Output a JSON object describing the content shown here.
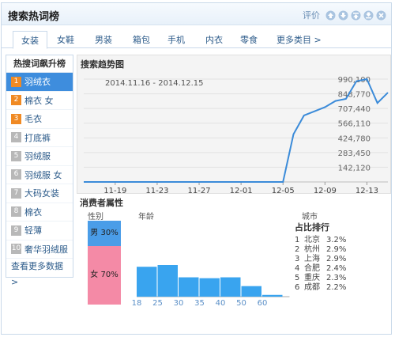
{
  "header": {
    "title": "搜索热词榜",
    "rating_label": "评价"
  },
  "tabs": [
    {
      "label": "女装",
      "active": true
    },
    {
      "label": "女鞋"
    },
    {
      "label": "男装"
    },
    {
      "label": "箱包"
    },
    {
      "label": "手机"
    },
    {
      "label": "内衣"
    },
    {
      "label": "零食"
    },
    {
      "label": "更多类目 >"
    }
  ],
  "sidebar": {
    "title": "热搜词飙升榜",
    "items": [
      {
        "rank": "1",
        "label": "羽绒衣",
        "active": true
      },
      {
        "rank": "2",
        "label": "棉衣 女"
      },
      {
        "rank": "3",
        "label": "毛衣"
      },
      {
        "rank": "4",
        "label": "打底裤"
      },
      {
        "rank": "5",
        "label": "羽绒服"
      },
      {
        "rank": "6",
        "label": "羽绒服 女"
      },
      {
        "rank": "7",
        "label": "大码女装"
      },
      {
        "rank": "8",
        "label": "棉衣"
      },
      {
        "rank": "9",
        "label": "轻薄"
      },
      {
        "rank": "10",
        "label": "奢华羽绒服"
      }
    ],
    "more_label": "查看更多数据 >"
  },
  "trend": {
    "title": "搜索趋势图",
    "date_range": "2014.11.16 - 2014.12.15"
  },
  "chart_data": [
    {
      "type": "line",
      "title": "搜索趋势图",
      "xlabel": "",
      "ylabel": "",
      "x_ticks": [
        "11-19",
        "11-23",
        "11-27",
        "12-01",
        "12-05",
        "12-09",
        "12-13"
      ],
      "y_ticks": [
        "142,120",
        "283,450",
        "424,780",
        "566,110",
        "707,440",
        "848,770",
        "990,100"
      ],
      "ylim": [
        0,
        990100
      ],
      "series": [
        {
          "color": "#3b8bd9",
          "x": [
            "11-16",
            "11-17",
            "11-18",
            "11-19",
            "11-20",
            "11-21",
            "11-22",
            "11-23",
            "11-24",
            "11-25",
            "11-26",
            "11-27",
            "11-28",
            "11-29",
            "11-30",
            "12-01",
            "12-02",
            "12-03",
            "12-04",
            "12-05",
            "12-06",
            "12-07",
            "12-08",
            "12-09",
            "12-10",
            "12-11",
            "12-12",
            "12-13",
            "12-14",
            "12-15"
          ],
          "values": [
            0,
            0,
            0,
            0,
            0,
            0,
            0,
            0,
            0,
            0,
            0,
            0,
            0,
            0,
            0,
            0,
            0,
            0,
            0,
            0,
            460000,
            640000,
            680000,
            720000,
            780000,
            800000,
            970000,
            990100,
            760000,
            860000
          ]
        }
      ]
    },
    {
      "type": "bar",
      "title": "年龄",
      "categories": [
        "18",
        "25",
        "30",
        "35",
        "40",
        "50",
        "60"
      ],
      "values": [
        34,
        36,
        22,
        21,
        22,
        12,
        2
      ],
      "color": "#39a4ef"
    }
  ],
  "consumer": {
    "title": "消费者属性",
    "gender_label": "性别",
    "male_label": "男 30%",
    "female_label": "女 70%",
    "male_pct": 30,
    "female_pct": 70,
    "age_label": "年龄",
    "city_label": "城市",
    "city_rank_title": "占比排行",
    "cities": [
      {
        "rank": "1",
        "name": "北京",
        "pct": "3.2%"
      },
      {
        "rank": "2",
        "name": "杭州",
        "pct": "2.9%"
      },
      {
        "rank": "3",
        "name": "上海",
        "pct": "2.9%"
      },
      {
        "rank": "4",
        "name": "合肥",
        "pct": "2.4%"
      },
      {
        "rank": "5",
        "name": "重庆",
        "pct": "2.3%"
      },
      {
        "rank": "6",
        "name": "成都",
        "pct": "2.2%"
      }
    ]
  },
  "colors": {
    "accent": "#3e8ddd",
    "rank_hot": "#f08a24",
    "male": "#4a9de8",
    "female": "#f48aa6",
    "line": "#3b8bd9",
    "age_bar": "#39a4ef"
  }
}
